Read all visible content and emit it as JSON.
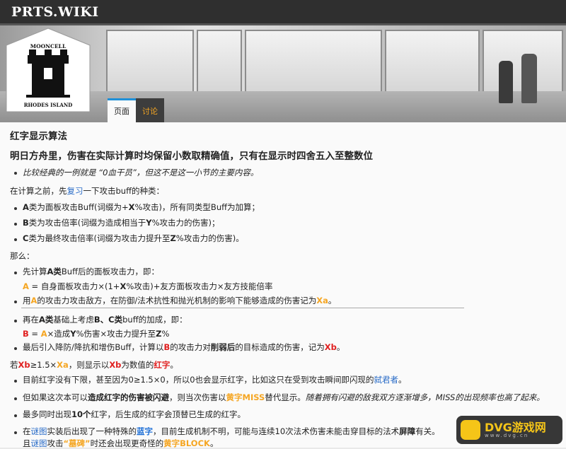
{
  "header": {
    "site_title": "PRTS.WIKI"
  },
  "badge": {
    "top_text": "MOONCELL",
    "bottom_text": "RHODES ISLAND"
  },
  "tabs": [
    {
      "label": "页面"
    },
    {
      "label": "讨论"
    }
  ],
  "content": {
    "section_title": "红字显示算法",
    "subtitle": "明日方舟里，伤害在实际计算时均保留小数取精确值，只有在显示时四舍五入至整数位",
    "note": "比较经典的一例就是 “0血干员”，但这不是这一小节的主要内容。",
    "intro": {
      "pre": "在计算之前，先",
      "link": "复习",
      "post": "一下攻击buff的种类："
    },
    "types": [
      {
        "key": "A",
        "text_a": "类为面板攻击Buff(词缀为+",
        "var": "X",
        "text_b": "%攻击)，所有同类型Buff为加算；"
      },
      {
        "key": "B",
        "text_a": "类为攻击倍率(词缀为造成相当于",
        "var": "Y",
        "text_b": "%攻击力的伤害)；"
      },
      {
        "key": "C",
        "text_a": "类为最终攻击倍率(词缀为攻击力提升至",
        "var": "Z",
        "text_b": "%攻击力的伤害)。"
      }
    ],
    "then": "那么：",
    "step1": {
      "pre": "先计算",
      "bold": "A类",
      "post": "Buff后的面板攻击力，即："
    },
    "formula_a": {
      "lhs": "A",
      "rhs_pre": " = 自身面板攻击力×(1+",
      "var": "X",
      "rhs_post": "%攻击)+友方面板攻击力×友方技能倍率"
    },
    "step2": {
      "pre": "用",
      "a": "A",
      "mid": "的攻击力攻击敌方，在防御/法术抗性和抛光机制的影响下能够造成的伤害记为",
      "x": "Xa",
      "post": "。"
    },
    "step3": {
      "pre": "再在",
      "bold": "A类",
      "mid": "基础上考虑",
      "b": "B、C类",
      "post": "buff的加成，即："
    },
    "formula_b": {
      "lhs": "B",
      "eq": " = ",
      "a": "A",
      "mid": "×造成",
      "y": "Y",
      "mid2": "%伤害×攻击力提升至",
      "z": "Z",
      "end": "%"
    },
    "step4": {
      "pre": "最后引入降防/降抗和增伤Buff，计算以",
      "b": "B",
      "mid": "的攻击力对",
      "bold": "削弱后",
      "mid2": "的目标造成的伤害，记为",
      "xb": "Xb",
      "post": "。"
    },
    "cond": {
      "pre": "若",
      "xb": "Xb",
      "mid": "≥1.5×",
      "xa": "Xa",
      "mid2": "，则显示以",
      "xb2": "Xb",
      "mid3": "为数值的",
      "red": "红字",
      "post": "。"
    },
    "note1": {
      "pre": "目前红字没有下限，甚至因为0≥1.5×0，所以0也会显示红字，比如这只在受到攻击瞬间即闪现的",
      "link": "弑君者",
      "post": "。"
    },
    "note2": {
      "pre": "但如果这次本可以",
      "bold": "造成红字的伤害被闪避",
      "mid": "，则当次伤害以",
      "miss": "黄字MISS",
      "mid2": "替代显示。",
      "it": "随着拥有闪避的敌我双方逐渐增多，MISS的出现频率也高了起来。"
    },
    "note3": {
      "pre": "最多同时出现",
      "bold": "10个",
      "post": "红字，后生成的红字会顶替已生成的红字。"
    },
    "note4": {
      "pre": "在",
      "link": "谜图",
      "mid": "实装后出现了一种特殊的",
      "blue": "蓝字",
      "mid2": "，目前生成机制不明，可能与连续10次法术伤害未能击穿目标的法术",
      "bold": "屏障",
      "post": "有关。"
    },
    "note5": {
      "pre": "且",
      "link": "谜图",
      "mid": "攻击",
      "quote": "“墓碑”",
      "mid2": "时还会出现更奇怪的",
      "block": "黄字BLOCK",
      "post": "。"
    }
  },
  "watermark": {
    "text": "DVG游戏网",
    "sub": "www.dvg.cn"
  },
  "colors": {
    "accent_orange": "#f5a623",
    "accent_red": "#e02020",
    "link_blue": "#2a6cc7"
  }
}
